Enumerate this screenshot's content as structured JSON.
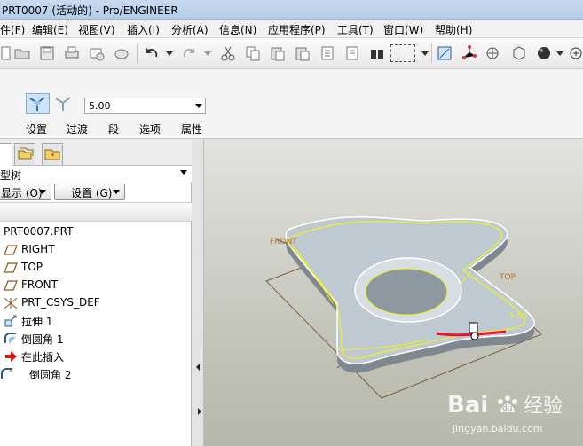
{
  "window": {
    "title": "PRT0007 (活动的) - Pro/ENGINEER"
  },
  "menu": [
    "件(F)",
    "编辑(E)",
    "视图(V)",
    "插入(I)",
    "分析(A)",
    "信息(N)",
    "应用程序(P)",
    "工具(T)",
    "窗口(W)",
    "帮助(H)"
  ],
  "dashboard": {
    "value": "5.00",
    "tabs": [
      "设置",
      "过渡",
      "段",
      "选项",
      "属性"
    ]
  },
  "model_tree": {
    "header": "型树",
    "show_button": "显示 (O)",
    "settings_button": "设置 (G)",
    "items": [
      {
        "label": "PRT0007.PRT",
        "icon": "part-icon"
      },
      {
        "label": "RIGHT",
        "icon": "datum-plane-icon"
      },
      {
        "label": "TOP",
        "icon": "datum-plane-icon"
      },
      {
        "label": "FRONT",
        "icon": "datum-plane-icon"
      },
      {
        "label": "PRT_CSYS_DEF",
        "icon": "csys-icon"
      },
      {
        "label": "拉伸 1",
        "icon": "extrude-icon"
      },
      {
        "label": "倒圆角 1",
        "icon": "round-icon"
      },
      {
        "label": "在此插入",
        "icon": "insert-arrow-icon"
      },
      {
        "label": "倒圆角 2",
        "icon": "round-icon"
      }
    ]
  },
  "viewport": {
    "datum_labels": {
      "front": "FRONT",
      "top": "TOP",
      "dimension": "5.00"
    }
  },
  "watermark": {
    "brand": "Bai",
    "paw": "du",
    "cn": "经验",
    "url": "jingyan.baidu.com"
  }
}
